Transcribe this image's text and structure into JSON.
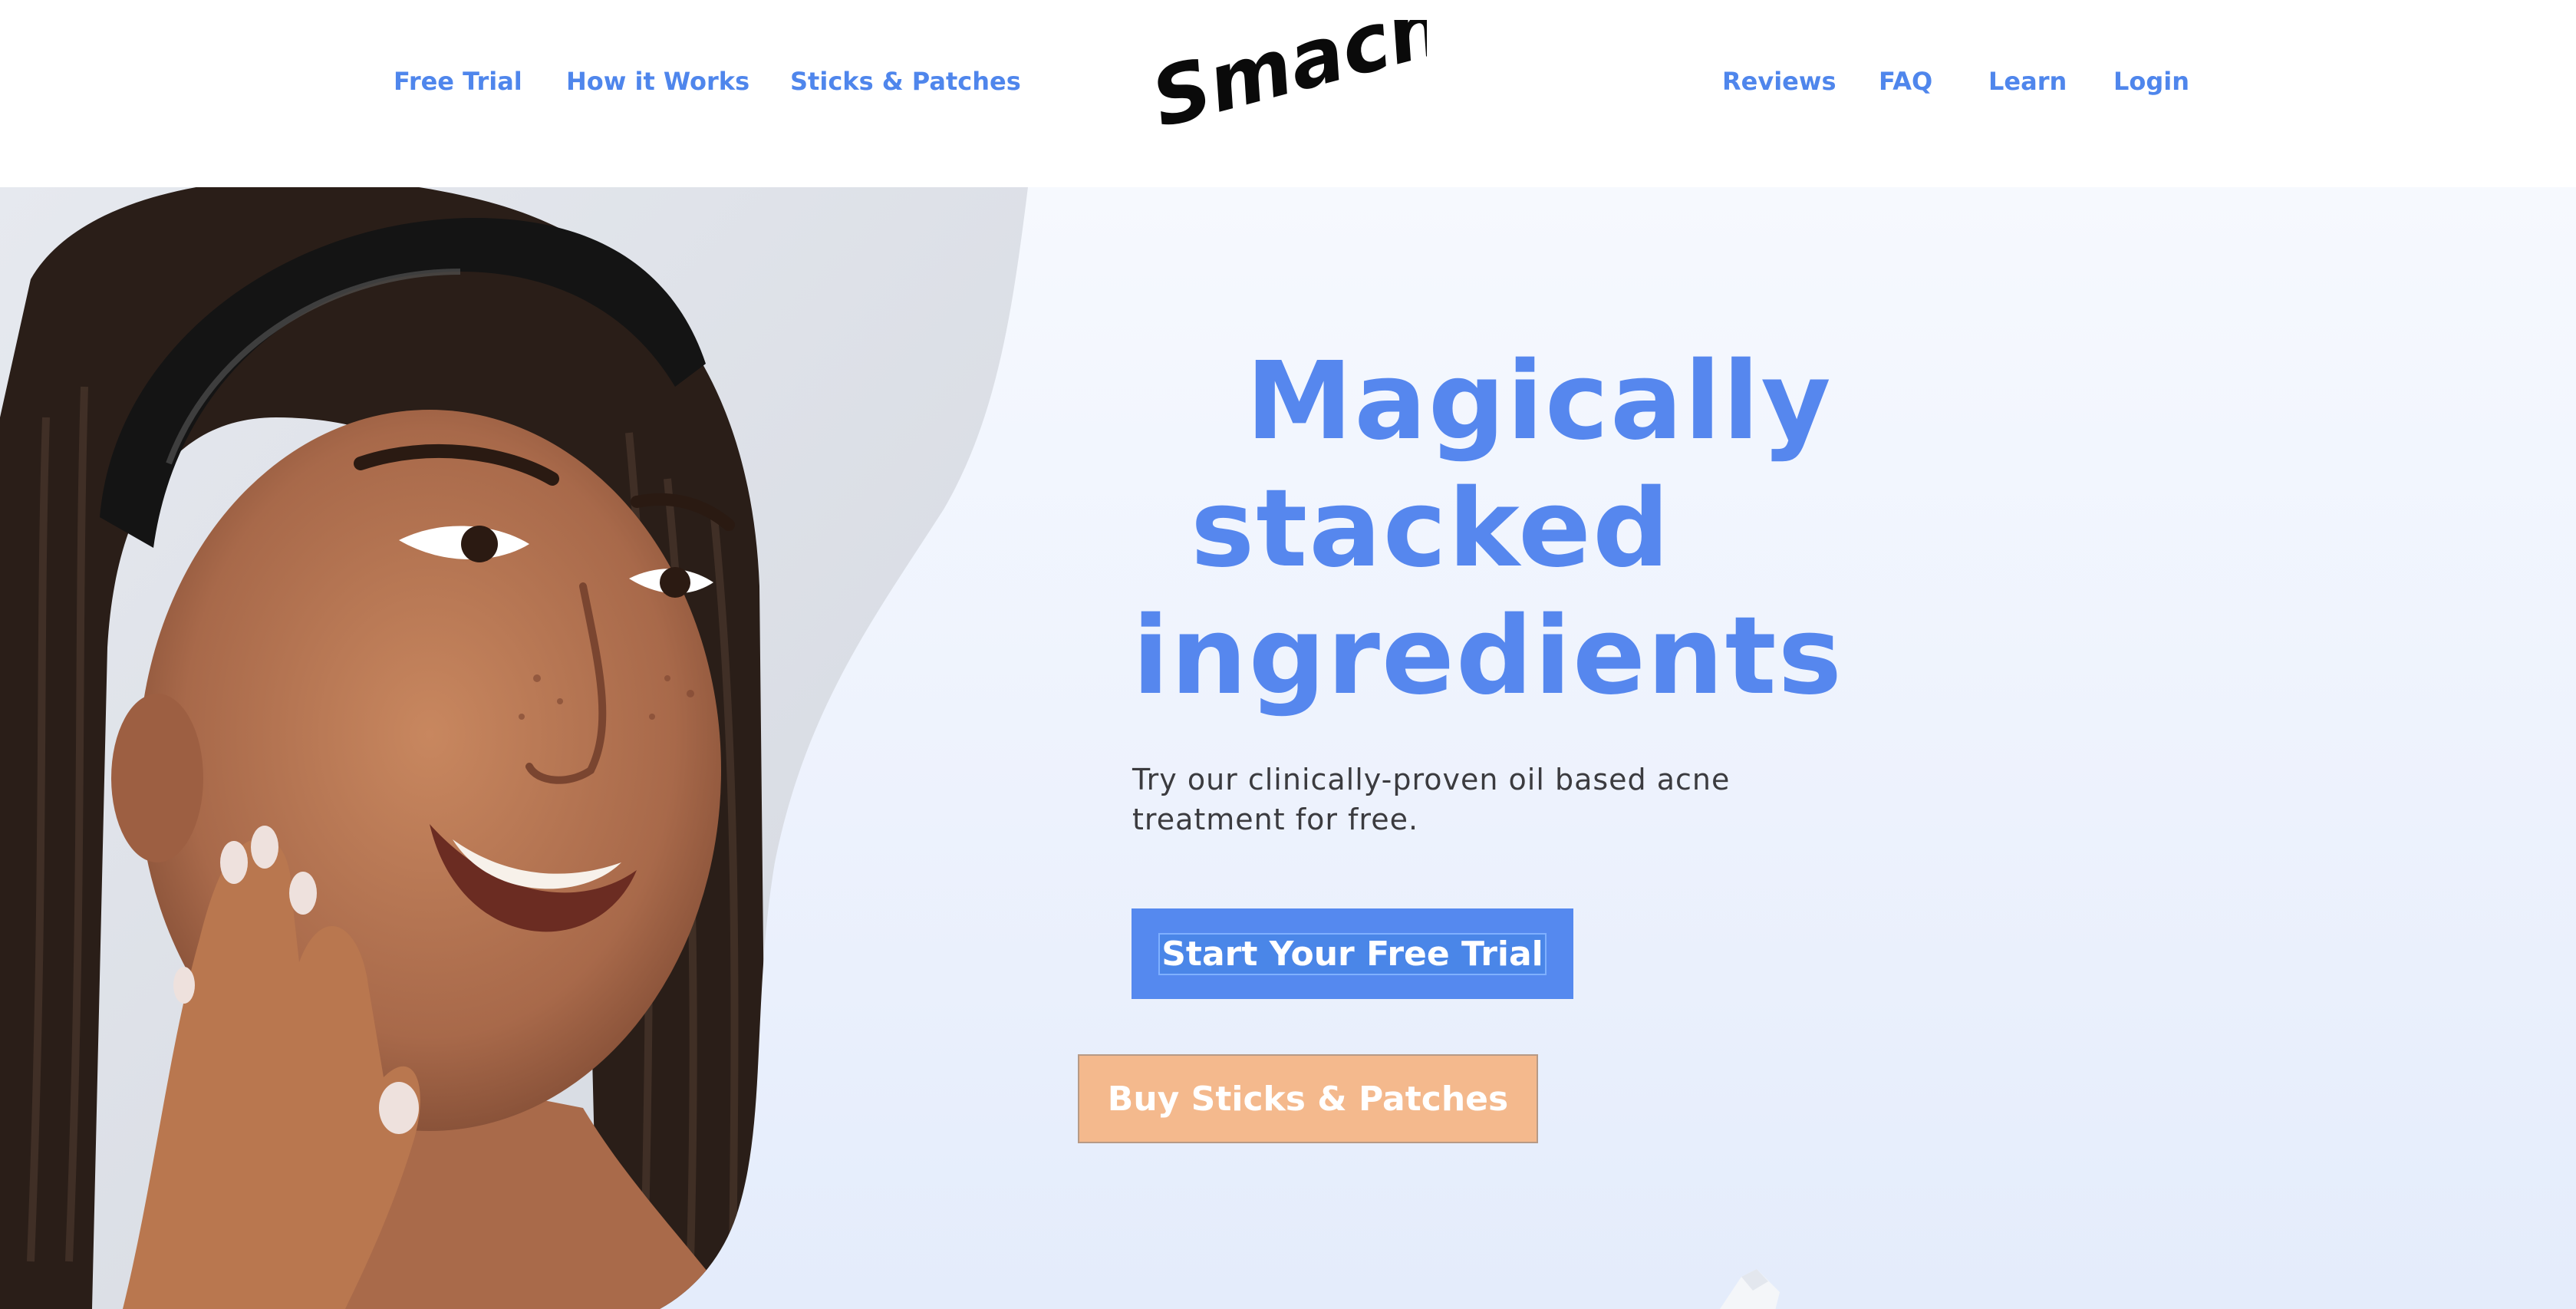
{
  "nav": {
    "left": [
      "Free Trial",
      "How it Works",
      "Sticks & Patches"
    ],
    "right": [
      "Reviews",
      "FAQ",
      "Learn",
      "Login"
    ],
    "logo_text": "Smacne"
  },
  "hero": {
    "headline": [
      "Magically",
      "stacked",
      "ingredients"
    ],
    "subtitle": "Try our clinically-proven oil based acne treatment for free.",
    "primary_cta": "Start Your Free Trial",
    "secondary_cta": "Buy Sticks & Patches"
  },
  "colors": {
    "brand_blue": "#5589ef",
    "nav_blue": "#4f86ec",
    "cta_peach": "#f4b98d",
    "text_dark": "#3b3b3f"
  },
  "icons": [
    "woman-smiling-photo",
    "smacne-logo",
    "product-package"
  ]
}
